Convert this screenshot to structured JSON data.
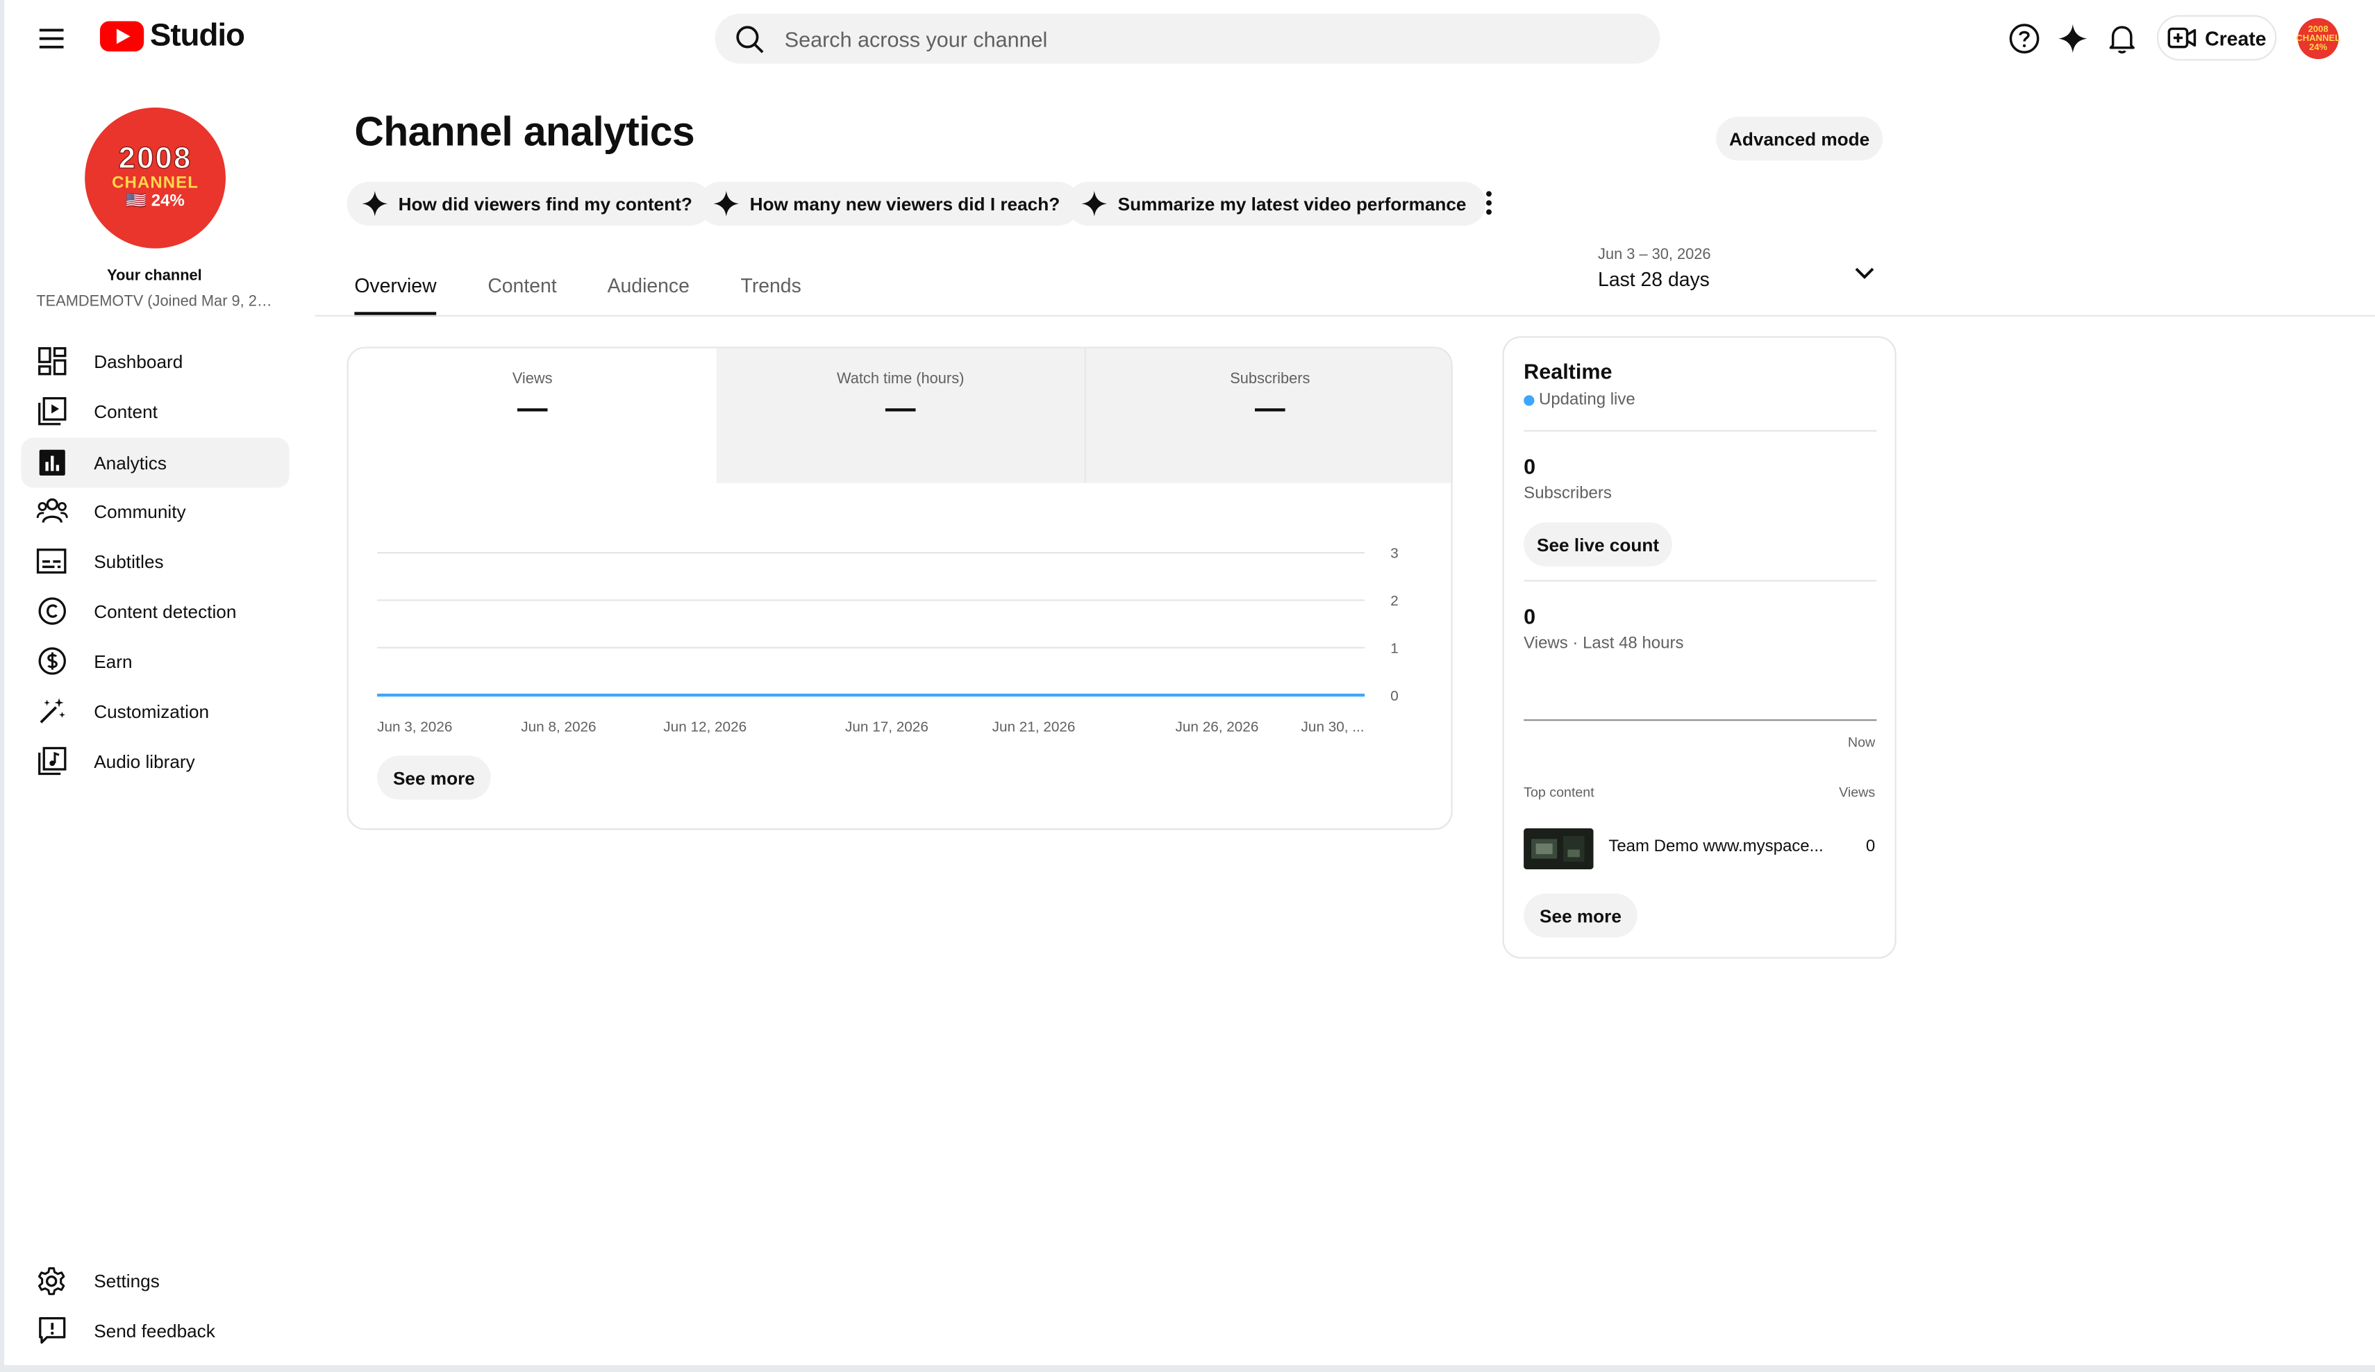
{
  "header": {
    "app_name": "Studio",
    "search_placeholder": "Search across your channel",
    "create_label": "Create",
    "avatar_text": "2008 CHANNEL 24%"
  },
  "sidebar": {
    "avatar_line1": "2008",
    "avatar_line2": "CHANNEL",
    "avatar_line3": "🇺🇸 24%",
    "your_channel": "Your channel",
    "channel_sub": "TEAMDEMOTV (Joined Mar 9, 200...",
    "items": [
      {
        "label": "Dashboard",
        "icon": "dashboard-icon"
      },
      {
        "label": "Content",
        "icon": "content-icon"
      },
      {
        "label": "Analytics",
        "icon": "analytics-icon",
        "active": true
      },
      {
        "label": "Community",
        "icon": "community-icon"
      },
      {
        "label": "Subtitles",
        "icon": "subtitles-icon"
      },
      {
        "label": "Content detection",
        "icon": "copyright-icon"
      },
      {
        "label": "Earn",
        "icon": "dollar-icon"
      },
      {
        "label": "Customization",
        "icon": "magic-wand-icon"
      },
      {
        "label": "Audio library",
        "icon": "audio-library-icon"
      }
    ],
    "bottom_items": [
      {
        "label": "Settings",
        "icon": "gear-icon"
      },
      {
        "label": "Send feedback",
        "icon": "feedback-icon"
      }
    ]
  },
  "main": {
    "title": "Channel analytics",
    "advanced_mode": "Advanced mode",
    "chips": [
      "How did viewers find my content?",
      "How many new viewers did I reach?",
      "Summarize my latest video performance"
    ],
    "date_range": "Jun 3 – 30, 2026",
    "date_period": "Last 28 days",
    "tabs": [
      "Overview",
      "Content",
      "Audience",
      "Trends"
    ],
    "metrics": [
      {
        "label": "Views",
        "value": "—"
      },
      {
        "label": "Watch time (hours)",
        "value": "—"
      },
      {
        "label": "Subscribers",
        "value": "—"
      }
    ],
    "see_more": "See more"
  },
  "chart_data": {
    "type": "line",
    "x": [
      "Jun 3, 2026",
      "Jun 8, 2026",
      "Jun 12, 2026",
      "Jun 17, 2026",
      "Jun 21, 2026",
      "Jun 26, 2026",
      "Jun 30, ..."
    ],
    "y_ticks": [
      "3",
      "2",
      "1",
      "0"
    ],
    "series": [
      {
        "values": [
          0,
          0,
          0,
          0,
          0,
          0,
          0
        ]
      }
    ],
    "ylim": [
      0,
      3
    ],
    "grid": true,
    "line_color": "#3ea6ff"
  },
  "realtime": {
    "title": "Realtime",
    "live": "Updating live",
    "subs_value": "0",
    "subs_label": "Subscribers",
    "see_live_count": "See live count",
    "views_value": "0",
    "views_label": "Views · Last 48 hours",
    "now": "Now",
    "top_content": "Top content",
    "views_col": "Views",
    "video_title": "Team Demo www.myspace...",
    "video_views": "0",
    "see_more": "See more"
  },
  "colors": {
    "accent": "#ff0000",
    "live_dot": "#3ea6ff",
    "avatar_bg": "#e9352c"
  }
}
